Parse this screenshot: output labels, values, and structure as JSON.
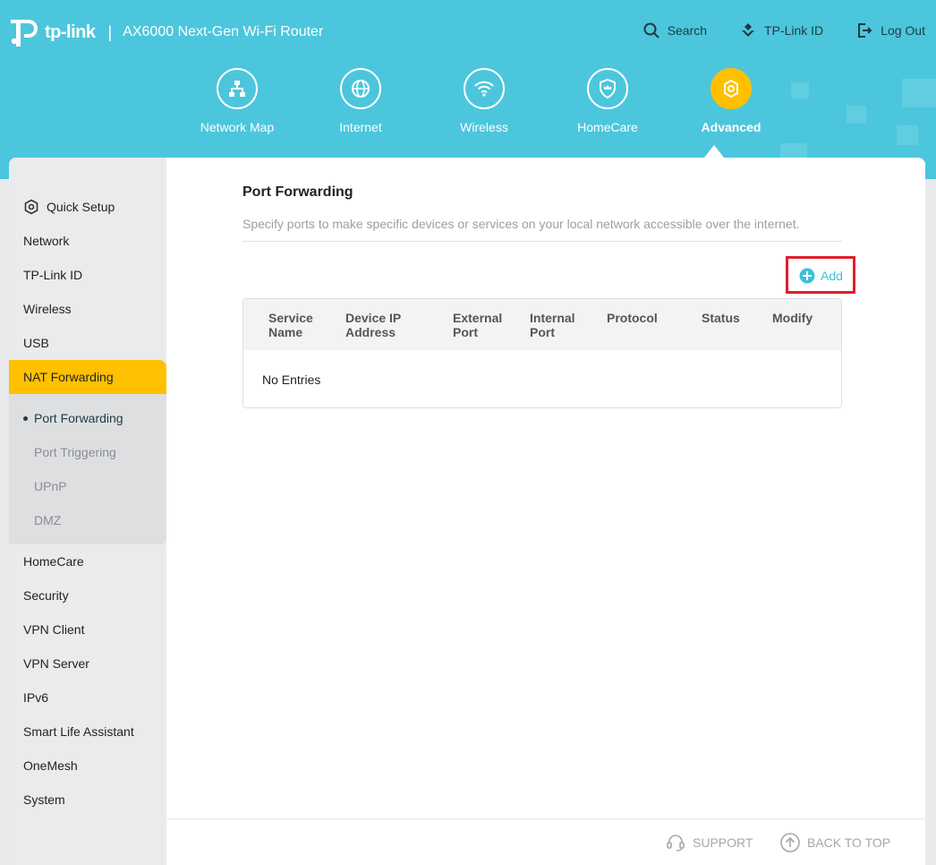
{
  "brand": {
    "logo_text": "tp-link",
    "separator": "|",
    "product": "AX6000 Next-Gen Wi-Fi Router"
  },
  "top_links": {
    "search": "Search",
    "tplink_id": "TP-Link ID",
    "logout": "Log Out"
  },
  "nav": {
    "network_map": "Network Map",
    "internet": "Internet",
    "wireless": "Wireless",
    "homecare": "HomeCare",
    "advanced": "Advanced",
    "active": "Advanced"
  },
  "sidebar": {
    "quick_setup": "Quick Setup",
    "network": "Network",
    "tplink_id": "TP-Link ID",
    "wireless": "Wireless",
    "usb": "USB",
    "nat_forwarding": "NAT Forwarding",
    "sub": {
      "port_forwarding": "Port Forwarding",
      "port_triggering": "Port Triggering",
      "upnp": "UPnP",
      "dmz": "DMZ"
    },
    "homecare": "HomeCare",
    "security": "Security",
    "vpn_client": "VPN Client",
    "vpn_server": "VPN Server",
    "ipv6": "IPv6",
    "smart_life": "Smart Life Assistant",
    "onemesh": "OneMesh",
    "system": "System"
  },
  "main": {
    "title": "Port Forwarding",
    "description": "Specify ports to make specific devices or services on your local network accessible over the internet.",
    "add_label": "Add",
    "table": {
      "headers": {
        "service_1": "Service",
        "service_2": "Name",
        "device_1": "Device IP",
        "device_2": "Address",
        "external_1": "External",
        "external_2": "Port",
        "internal_1": "Internal",
        "internal_2": "Port",
        "protocol": "Protocol",
        "status": "Status",
        "modify": "Modify"
      },
      "empty_text": "No Entries"
    }
  },
  "footer": {
    "support": "SUPPORT",
    "back_to_top": "BACK TO TOP"
  },
  "colors": {
    "header_bg": "#4cc6dc",
    "accent_yellow": "#ffc000",
    "link_teal": "#3fc0d8",
    "highlight_red": "#e01e2a"
  }
}
